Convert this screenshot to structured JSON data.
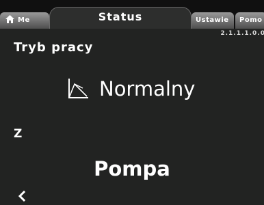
{
  "tabs": {
    "home_label": "Me",
    "status_label": "Status",
    "settings_label": "Ustawie",
    "help_label": "Pomo"
  },
  "version": "2.1.1.1.0.0",
  "mode": {
    "label": "Tryb pracy",
    "value": "Normalny",
    "icon": "normal-mode-icon"
  },
  "source": {
    "label": "Z",
    "value": "Pompa"
  },
  "nav": {
    "back_icon": "chevron-left-icon"
  }
}
